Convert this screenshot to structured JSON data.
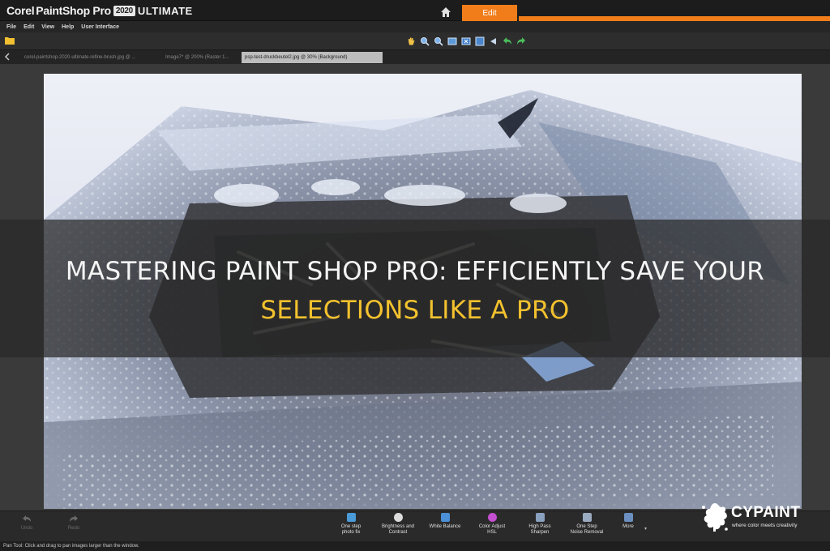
{
  "app": {
    "brand": "Corel",
    "product": "PaintShop Pro",
    "version": "2020",
    "edition": "ULTIMATE",
    "tabs": {
      "edit": "Edit"
    },
    "accent_color": "#f07d1a"
  },
  "menu": [
    "File",
    "Edit",
    "View",
    "Help",
    "User Interface"
  ],
  "toolbar": {
    "icons": [
      "pan-icon",
      "zoom-in-icon",
      "zoom-out-icon",
      "fit-window-icon",
      "actual-size-icon",
      "fit-screen-icon",
      "prev-image-icon",
      "undo-arrow-icon",
      "redo-arrow-icon"
    ]
  },
  "document_tabs": [
    "corel-paintshop-2020-ultimate-refine-brush.jpg @ ...",
    "Image7* @ 200% (Raster 1...",
    "psp-test-druckbeutel2.jpg @ 30% (Background)"
  ],
  "headline": {
    "line1": "MASTERING PAINT SHOP PRO: EFFICIENTLY SAVE YOUR",
    "line2": "SELECTIONS LIKE A PRO"
  },
  "bottom": {
    "undo": "Undo",
    "redo": "Redo",
    "effects": [
      {
        "label1": "One step",
        "label2": "photo fix",
        "color": "#4a9ad8"
      },
      {
        "label1": "Brightness and",
        "label2": "Contrast",
        "color": "#dcdcdc"
      },
      {
        "label1": "White Balance",
        "label2": "",
        "color": "#4b8fd6"
      },
      {
        "label1": "Color Adjust",
        "label2": "HSL",
        "color": "#c44fd0"
      },
      {
        "label1": "High Pass",
        "label2": "Sharpen",
        "color": "#8aa0bf"
      },
      {
        "label1": "One Step",
        "label2": "Noise Removal",
        "color": "#9aaabf"
      },
      {
        "label1": "More",
        "label2": "",
        "color": "#6b8fc0"
      }
    ]
  },
  "status": "Pan Tool: Click and drag to pan images larger than the window.",
  "watermark": {
    "name": "CYPAINT",
    "tagline": "where color meets creativity"
  }
}
